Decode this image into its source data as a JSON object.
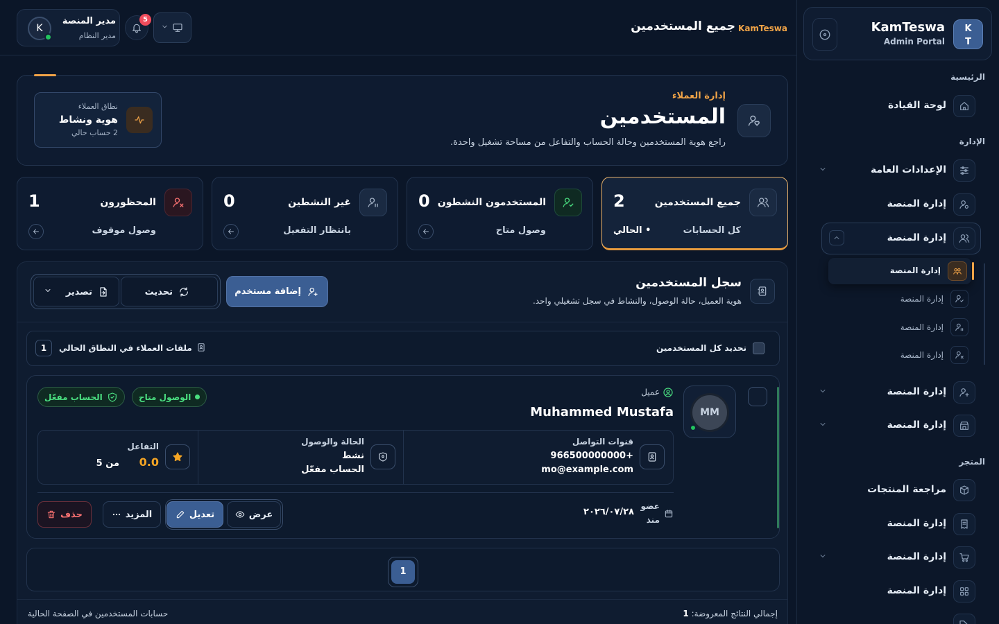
{
  "app": {
    "brand_name": "KamTeswa",
    "brand_sub": "Admin Portal",
    "logo_line1": "K",
    "logo_line2": "T"
  },
  "topbar": {
    "title": "جميع المستخدمين",
    "brand": "KamTeswa",
    "notif_count": "5",
    "user_initial": "K",
    "user_name": "مدير المنصة",
    "user_role": "مدير النظام"
  },
  "sidebar": {
    "sections": {
      "main": "الرئيسية",
      "admin": "الإدارة",
      "store": "المتجر"
    },
    "dashboard": "لوحة القيادة",
    "general_settings": "الإعدادات العامة",
    "platform_1": "إدارة المنصة",
    "platform_open": "إدارة المنصة",
    "sub_items": [
      "إدارة المنصة",
      "إدارة المنصة",
      "إدارة المنصة",
      "إدارة المنصة"
    ],
    "platform_2": "إدارة المنصة",
    "platform_3": "إدارة المنصة",
    "products_review": "مراجعة المنتجات",
    "platform_4": "إدارة المنصة",
    "platform_5": "إدارة المنصة",
    "platform_6": "إدارة المنصة"
  },
  "hero": {
    "kicker": "إدارة العملاء",
    "title": "المستخدمين",
    "desc": "راجع هوية المستخدمين وحالة الحساب والتفاعل من مساحة تشغيل واحدة.",
    "scope_label": "نطاق العملاء",
    "scope_value": "هوية ونشاط",
    "scope_count": "2 حساب حالي"
  },
  "stats": [
    {
      "label": "جميع المستخدمين",
      "value": "2",
      "sub": "كل الحسابات",
      "current": "• الحالي"
    },
    {
      "label": "المستخدمون النشطون",
      "value": "0",
      "sub": "وصول متاح"
    },
    {
      "label": "غير النشطين",
      "value": "0",
      "sub": "بانتظار التفعيل"
    },
    {
      "label": "المحظورون",
      "value": "1",
      "sub": "وصول موقوف"
    }
  ],
  "panel": {
    "title": "سجل المستخدمين",
    "desc": "هوية العميل، حالة الوصول، والنشاط في سجل تشغيلي واحد.",
    "add_btn": "إضافة مستخدم",
    "refresh_btn": "تحديث",
    "export_btn": "تصدير",
    "select_all": "تحديد كل المستخدمين",
    "files_label": "ملفات العملاء في النطاق الحالي",
    "files_count": "1"
  },
  "user": {
    "initials": "MM",
    "role": "عميل",
    "name": "Muhammed Mustafa",
    "status_pill": "الوصول متاح",
    "account_pill": "الحساب مفعّل",
    "contact_title": "قنوات التواصل",
    "phone": "+966500000000",
    "email": "mo@example.com",
    "state_title": "الحالة والوصول",
    "state_value": "نشط",
    "state_account": "الحساب مفعّل",
    "engage_title": "التفاعل",
    "engage_value": "0.0",
    "engage_of": "من 5",
    "member_label": "عضو",
    "member_since": "منذ",
    "member_date": "٢٠٢٦/٠٧/٢٨",
    "view_btn": "عرض",
    "edit_btn": "تعديل",
    "more_btn": "المزيد",
    "delete_btn": "حذف"
  },
  "pagination": {
    "current": "1"
  },
  "footer": {
    "total_label": "إجمالي النتائج المعروضة:",
    "total_value": "1",
    "page_note": "حسابات المستخدمين في الصفحة الحالية"
  },
  "colors": {
    "bg": "#0b1628",
    "accent": "#f0a347",
    "primary": "#3b5e93",
    "success": "#4ade80",
    "danger": "#f87171"
  }
}
